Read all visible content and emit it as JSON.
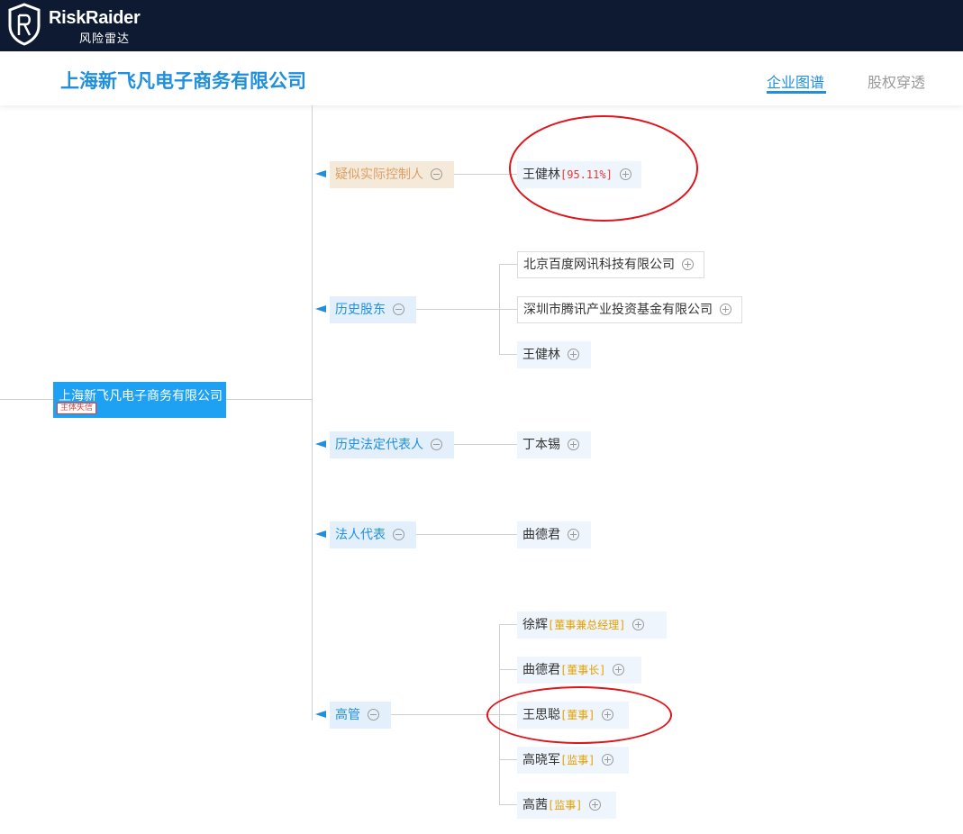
{
  "brand": {
    "name": "RiskRaider",
    "subtitle": "风险雷达"
  },
  "header": {
    "company_name": "上海新飞凡电子商务有限公司",
    "tabs": [
      {
        "label": "企业图谱",
        "active": true
      },
      {
        "label": "股权穿透",
        "active": false
      }
    ]
  },
  "graph": {
    "root": {
      "label": "上海新飞凡电子商务有限公司",
      "badge": "主体失信"
    },
    "categories": [
      {
        "label": "疑似实际控制人",
        "children": [
          {
            "name": "王健林",
            "tag": "[95.11%]"
          }
        ]
      },
      {
        "label": "历史股东",
        "children": [
          {
            "name": "北京百度网讯科技有限公司"
          },
          {
            "name": "深圳市腾讯产业投资基金有限公司"
          },
          {
            "name": "王健林"
          }
        ]
      },
      {
        "label": "历史法定代表人",
        "children": [
          {
            "name": "丁本锡"
          }
        ]
      },
      {
        "label": "法人代表",
        "children": [
          {
            "name": "曲德君"
          }
        ]
      },
      {
        "label": "高管",
        "children": [
          {
            "name": "徐辉",
            "tag": "[董事兼总经理]"
          },
          {
            "name": "曲德君",
            "tag": "[董事长]"
          },
          {
            "name": "王思聪",
            "tag": "[董事]"
          },
          {
            "name": "高晓军",
            "tag": "[监事]"
          },
          {
            "name": "高茜",
            "tag": "[监事]"
          }
        ]
      }
    ]
  },
  "colors": {
    "accent": "#1f8fde",
    "topbar": "#0d1a31",
    "highlight_ellipse": "#e0141b",
    "tag": "#e5a000"
  },
  "icons": {
    "collapse": "minus-circle-icon",
    "expand": "plus-circle-icon",
    "pointer": "left-arrow-icon"
  }
}
